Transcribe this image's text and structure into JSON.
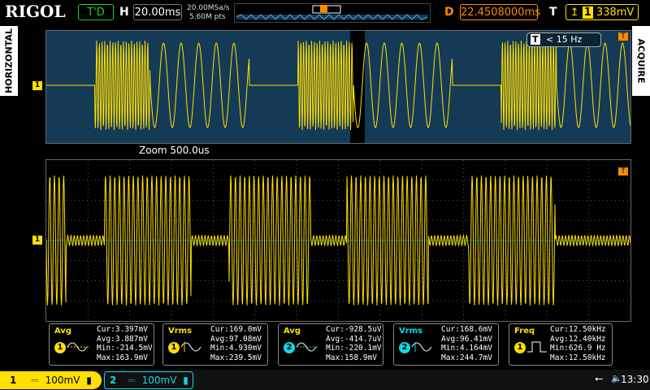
{
  "top": {
    "brand": "RIGOL",
    "run_status": "T'D",
    "h_label": "H",
    "timebase": "20.00ms",
    "sample_rate": "20.00MSa/s",
    "mem_depth": "5.60M pts",
    "d_label": "D",
    "delay": "22.4508000ms",
    "t_label": "T",
    "trigger_level": "338mV",
    "colors": {
      "accent": "#ff8c00",
      "ch1": "#ffe000",
      "ch2": "#10d8e8"
    }
  },
  "side": {
    "left_tab": "HORIZONTAL",
    "right_tab": "ACQUIRE"
  },
  "overview": {
    "freq_badge_letter": "T",
    "freq_text": "< 15 Hz",
    "zoom_label": "Zoom  500.0us"
  },
  "markers": {
    "trig": "T",
    "ch1": "1"
  },
  "measurements": [
    {
      "name": "Avg",
      "channel": "1",
      "lines": [
        "Cur:3.397mV",
        "Avg:3.887mV",
        "Min:-214.5mV",
        "Max:163.9mV"
      ]
    },
    {
      "name": "Vrms",
      "channel": "1",
      "lines": [
        "Cur:169.0mV",
        "Avg:97.08mV",
        "Min:4.930mV",
        "Max:239.5mV"
      ]
    },
    {
      "name": "Avg",
      "channel": "2",
      "lines": [
        "Cur:-928.5uV",
        "Avg:-414.7uV",
        "Min:-220.1mV",
        "Max:158.9mV"
      ]
    },
    {
      "name": "Vrms",
      "channel": "2",
      "lines": [
        "Cur:168.6mV",
        "Avg:96.41mV",
        "Min:4.164mV",
        "Max:244.7mV"
      ]
    },
    {
      "name": "Freq",
      "channel": "1",
      "lines": [
        "Cur:12.50kHz",
        "Avg:12.40kHz",
        "Min:626.9 Hz",
        "Max:12.50kHz"
      ]
    }
  ],
  "bottom": {
    "ch1_num": "1",
    "ch1_scale": "100mV",
    "ch2_num": "2",
    "ch2_scale": "100mV",
    "time": "13:30"
  }
}
